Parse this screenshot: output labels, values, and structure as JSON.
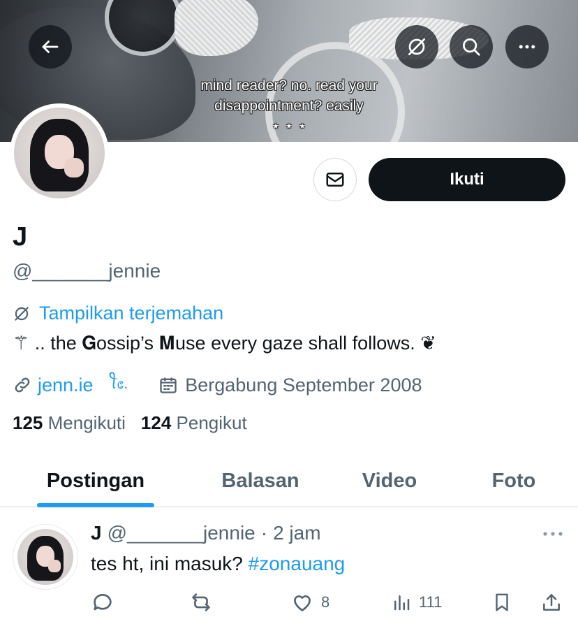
{
  "banner": {
    "caption_line1": "mind reader? no. read your",
    "caption_line2": "disappointment? easily",
    "caption_line3": "⋆ ⋆ ⋆"
  },
  "top_bar": {
    "back_icon": "arrow-left-icon",
    "translate_icon": "translate-icon",
    "search_icon": "search-icon",
    "more_icon": "more-horizontal-icon"
  },
  "actions": {
    "message_icon": "envelope-icon",
    "follow_label": "Ikuti"
  },
  "profile": {
    "display_name": "J",
    "handle": "@_______jennie",
    "translate_label": "Tampilkan terjemahan",
    "bio": "⚚ .. the 𝐆ossip’s 𝐌use every gaze shall follows. ❦",
    "website": "jenn.ie",
    "website_suffix": "ꪻ᥋.",
    "joined": "Bergabung September 2008",
    "following_count": "125",
    "following_label": "Mengikuti",
    "followers_count": "124",
    "followers_label": "Pengikut"
  },
  "tabs": [
    {
      "label": "Postingan",
      "active": true
    },
    {
      "label": "Balasan",
      "active": false
    },
    {
      "label": "Video",
      "active": false
    },
    {
      "label": "Foto",
      "active": false
    }
  ],
  "post": {
    "name": "J",
    "handle": "@_______jennie",
    "separator": "·",
    "time": "2 jam",
    "text": "tes ht, ini masuk? ",
    "hashtag": "#zonauang",
    "likes": "8",
    "views": "111"
  },
  "colors": {
    "accent": "#1d9bf0",
    "text_primary": "#0f1419",
    "text_secondary": "#536471",
    "button_dark": "#0f1419",
    "border": "#cfd9de"
  }
}
